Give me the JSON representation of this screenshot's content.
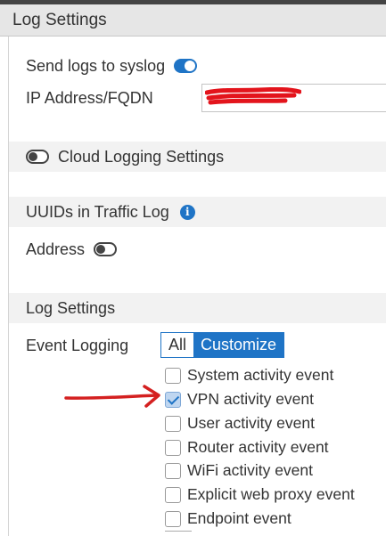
{
  "header": {
    "title": "Log Settings"
  },
  "syslog": {
    "label": "Send logs to syslog",
    "enabled": true
  },
  "ip": {
    "label": "IP Address/FQDN",
    "value": ""
  },
  "cloud": {
    "label": "Cloud Logging Settings",
    "enabled": false
  },
  "uuids": {
    "title": "UUIDs in Traffic Log",
    "address_label": "Address",
    "address_enabled": false
  },
  "log_settings": {
    "title": "Log Settings",
    "event_logging_label": "Event Logging",
    "options": [
      "All",
      "Customize"
    ],
    "selected": "Customize"
  },
  "events": [
    {
      "label": "System activity event",
      "checked": false
    },
    {
      "label": "VPN activity event",
      "checked": true
    },
    {
      "label": "User activity event",
      "checked": false
    },
    {
      "label": "Router activity event",
      "checked": false
    },
    {
      "label": "WiFi activity event",
      "checked": false
    },
    {
      "label": "Explicit web proxy event",
      "checked": false
    },
    {
      "label": "Endpoint event",
      "checked": false
    }
  ],
  "colors": {
    "accent": "#1f74c6",
    "annotation": "#d42020",
    "section_bg": "#f2f2f2"
  },
  "icons": {
    "info": "info-icon",
    "toggle": "toggle-switch",
    "checkbox": "checkbox",
    "annotation": "red-arrow"
  }
}
